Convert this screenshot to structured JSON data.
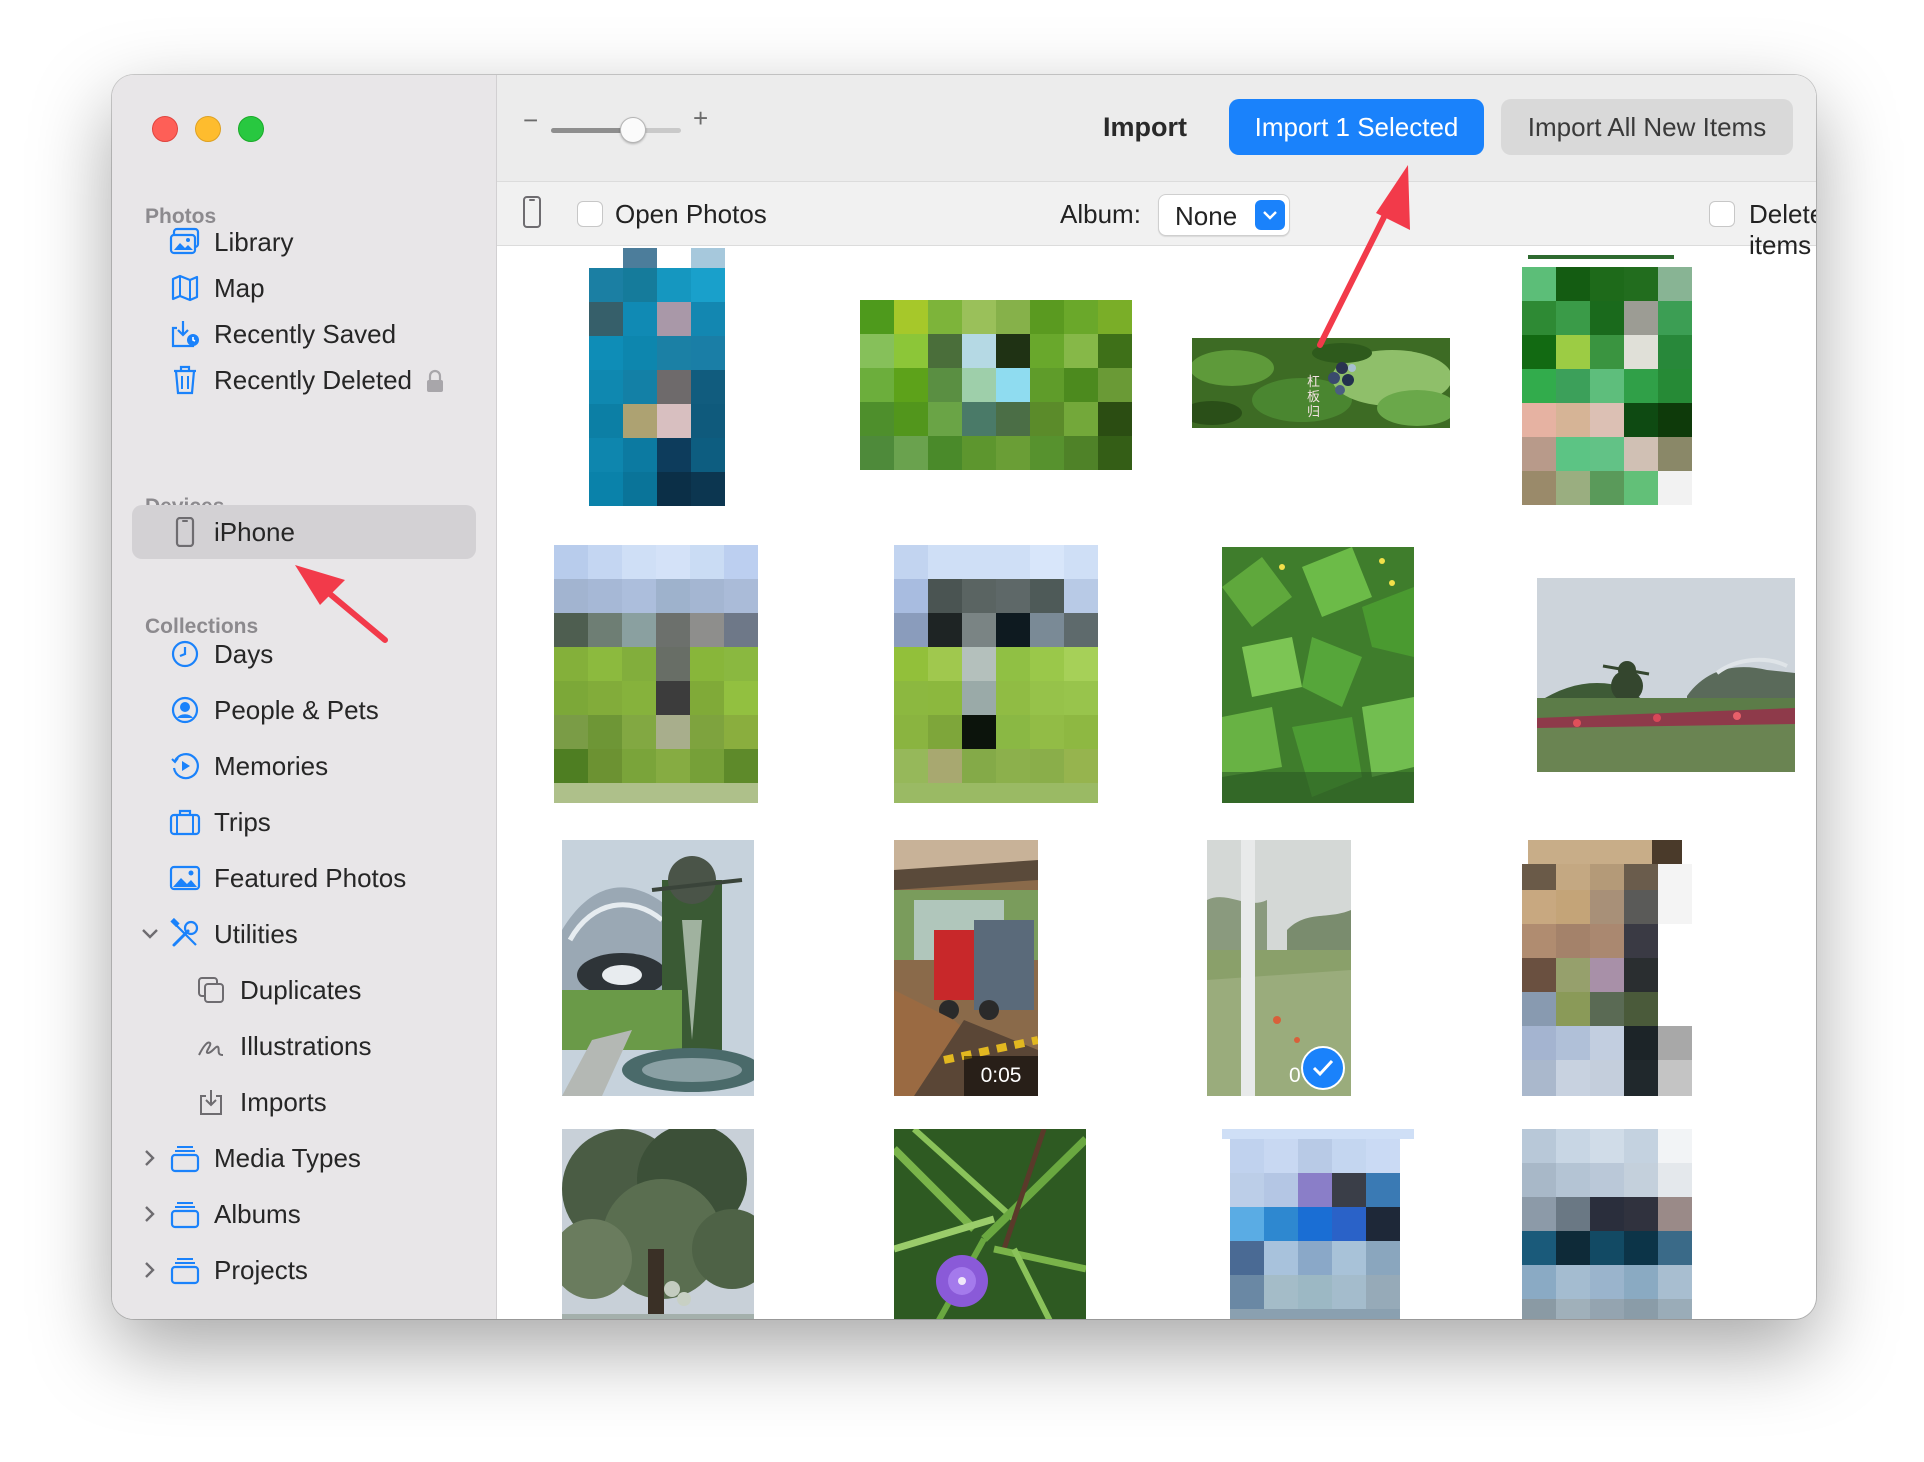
{
  "toolbar": {
    "zoom_out": "−",
    "zoom_in": "+",
    "zoom_level": 0.65,
    "title": "Import",
    "import_selected": "Import 1 Selected",
    "import_all": "Import All New Items"
  },
  "subbar": {
    "open_photos_label": "Open Photos",
    "open_photos_checked": false,
    "album_label": "Album:",
    "album_value": "None",
    "delete_items_label": "Delete items",
    "delete_items_checked": false
  },
  "sidebar": {
    "sections": {
      "photos": "Photos",
      "devices": "Devices",
      "collections": "Collections"
    },
    "photos_items": [
      {
        "label": "Library",
        "icon": "library-icon"
      },
      {
        "label": "Map",
        "icon": "map-icon"
      },
      {
        "label": "Recently Saved",
        "icon": "recently-saved-icon"
      },
      {
        "label": "Recently Deleted",
        "icon": "trash-icon"
      }
    ],
    "device_items": [
      {
        "label": "iPhone",
        "icon": "iphone-icon",
        "selected": true
      }
    ],
    "collection_items": [
      {
        "label": "Days",
        "icon": "clock-icon"
      },
      {
        "label": "People & Pets",
        "icon": "person-icon"
      },
      {
        "label": "Memories",
        "icon": "memories-icon"
      },
      {
        "label": "Trips",
        "icon": "suitcase-icon"
      },
      {
        "label": "Featured Photos",
        "icon": "featured-photos-icon"
      },
      {
        "label": "Utilities",
        "icon": "tools-icon",
        "expanded": true
      },
      {
        "label": "Duplicates",
        "icon": "duplicates-icon"
      },
      {
        "label": "Illustrations",
        "icon": "illustrations-icon"
      },
      {
        "label": "Imports",
        "icon": "imports-icon"
      },
      {
        "label": "Media Types",
        "icon": "stack-icon",
        "expanded": false
      },
      {
        "label": "Albums",
        "icon": "stack-icon",
        "expanded": false
      },
      {
        "label": "Projects",
        "icon": "stack-icon",
        "expanded": false
      }
    ]
  },
  "photos": [
    {
      "kind": "pixelated"
    },
    {
      "kind": "pixelated"
    },
    {
      "kind": "photo"
    },
    {
      "kind": "pixelated"
    },
    {
      "kind": "pixelated"
    },
    {
      "kind": "pixelated"
    },
    {
      "kind": "photo"
    },
    {
      "kind": "photo"
    },
    {
      "kind": "photo"
    },
    {
      "kind": "video",
      "duration": "0:05"
    },
    {
      "kind": "video",
      "duration": "0",
      "selected": true
    },
    {
      "kind": "pixelated"
    },
    {
      "kind": "photo"
    },
    {
      "kind": "photo"
    },
    {
      "kind": "pixelated"
    },
    {
      "kind": "pixelated"
    }
  ],
  "colors": {
    "accent": "#1a82fb",
    "annotation_arrow": "#f23a4a",
    "sidebar_bg": "#e8e6e8",
    "selected_row": "#d3d1d4"
  }
}
